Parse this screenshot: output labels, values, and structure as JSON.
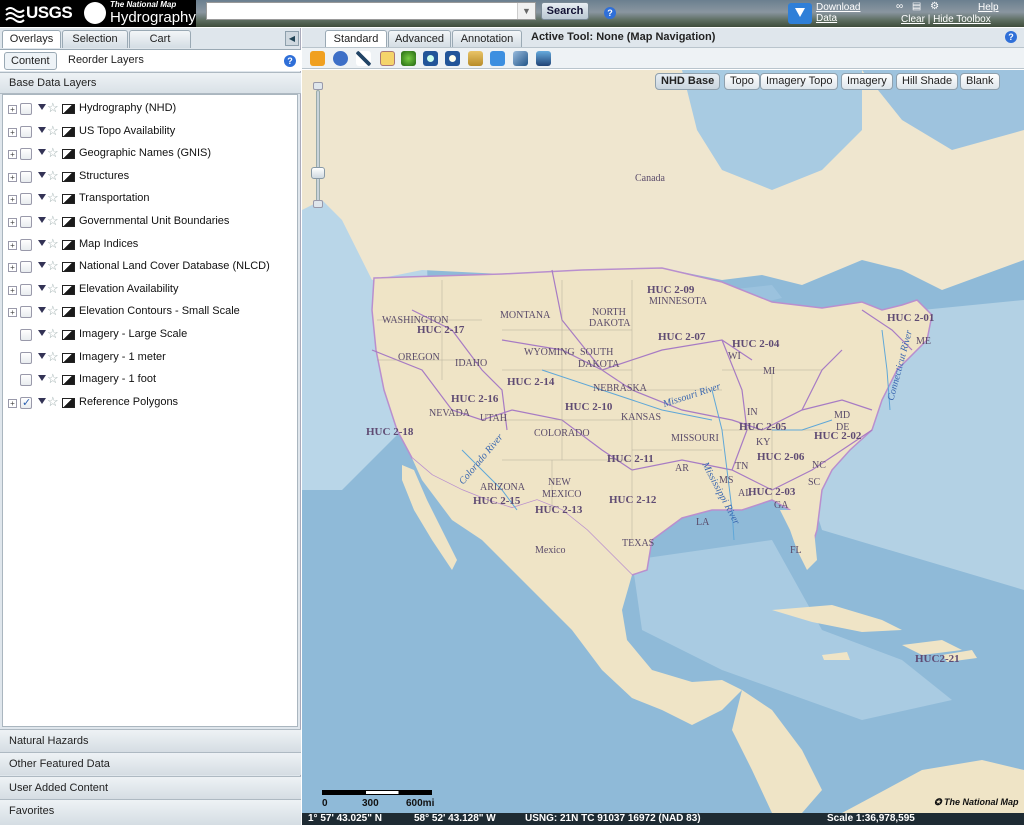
{
  "header": {
    "agency": "USGS",
    "tnm_small": "The National Map",
    "app_name": "Hydrography",
    "search_button": "Search",
    "download_label": "Download Data",
    "clear_link": "Clear",
    "hide_toolbox_link": "Hide Toolbox",
    "help_link": "Help",
    "separator": "|"
  },
  "left_panel": {
    "tabs": [
      "Overlays",
      "Selection",
      "Cart"
    ],
    "sub_tabs": [
      "Content",
      "Reorder Layers"
    ],
    "section_title": "Base Data Layers",
    "layers": [
      {
        "name": "Hydrography (NHD)",
        "expandable": true,
        "checked": false
      },
      {
        "name": "US Topo Availability",
        "expandable": true,
        "checked": false
      },
      {
        "name": "Geographic Names (GNIS)",
        "expandable": true,
        "checked": false
      },
      {
        "name": "Structures",
        "expandable": true,
        "checked": false
      },
      {
        "name": "Transportation",
        "expandable": true,
        "checked": false
      },
      {
        "name": "Governmental Unit Boundaries",
        "expandable": true,
        "checked": false
      },
      {
        "name": "Map Indices",
        "expandable": true,
        "checked": false
      },
      {
        "name": "National Land Cover Database (NLCD)",
        "expandable": true,
        "checked": false
      },
      {
        "name": "Elevation Availability",
        "expandable": true,
        "checked": false
      },
      {
        "name": "Elevation Contours - Small Scale",
        "expandable": true,
        "checked": false
      },
      {
        "name": "Imagery - Large Scale",
        "expandable": false,
        "checked": false
      },
      {
        "name": "Imagery - 1 meter",
        "expandable": false,
        "checked": false
      },
      {
        "name": "Imagery - 1 foot",
        "expandable": false,
        "checked": false
      },
      {
        "name": "Reference Polygons",
        "expandable": true,
        "checked": true
      }
    ],
    "accordion": [
      "Natural Hazards",
      "Other Featured Data",
      "User Added Content",
      "Favorites"
    ]
  },
  "toolbar": {
    "tabs": [
      "Standard",
      "Advanced",
      "Annotation"
    ],
    "active_tool": "Active Tool: None (Map Navigation)"
  },
  "map": {
    "basemaps": [
      "NHD Base",
      "Topo",
      "Imagery Topo",
      "Imagery",
      "Hill Shade",
      "Blank"
    ],
    "active_basemap": "NHD Base",
    "labels": {
      "canada": "Canada",
      "mexico": "Mexico",
      "washington": "WASHINGTON",
      "oregon": "OREGON",
      "idaho": "IDAHO",
      "montana": "MONTANA",
      "wyoming": "WYOMING",
      "nevada": "NEVADA",
      "utah": "UTAH",
      "colorado": "COLORADO",
      "arizona": "ARIZONA",
      "new_mexico_1": "NEW",
      "new_mexico_2": "MEXICO",
      "north_dakota_1": "NORTH",
      "north_dakota_2": "DAKOTA",
      "south_dakota_1": "SOUTH",
      "south_dakota_2": "DAKOTA",
      "nebraska": "NEBRASKA",
      "kansas": "KANSAS",
      "minnesota": "MINNESOTA",
      "missouri": "MISSOURI",
      "texas": "TEXAS",
      "wi": "WI",
      "mi": "MI",
      "in": "IN",
      "ky": "KY",
      "tn": "TN",
      "ar": "AR",
      "ms": "MS",
      "al": "AL",
      "ga": "GA",
      "sc": "SC",
      "nc": "NC",
      "fl": "FL",
      "la": "LA",
      "me": "ME",
      "md": "MD",
      "de": "DE"
    },
    "huc": [
      "HUC 2-01",
      "HUC 2-02",
      "HUC 2-03",
      "HUC 2-04",
      "HUC 2-05",
      "HUC 2-06",
      "HUC 2-07",
      "HUC 2-09",
      "HUC 2-10",
      "HUC 2-11",
      "HUC 2-12",
      "HUC 2-13",
      "HUC 2-14",
      "HUC 2-15",
      "HUC 2-16",
      "HUC 2-17",
      "HUC 2-18",
      "HUC2-21"
    ],
    "rivers": [
      "Missouri River",
      "Mississippi River",
      "Colorado River",
      "Connecticut River"
    ],
    "scale_ticks": [
      "0",
      "300",
      "600mi"
    ],
    "brand": "The National Map"
  },
  "status": {
    "lat": "1° 57' 43.025\" N",
    "lon": "58° 52' 43.128\" W",
    "usng": "USNG: 21N TC 91037 16972 (NAD 83)",
    "scale": "Scale 1:36,978,595"
  }
}
